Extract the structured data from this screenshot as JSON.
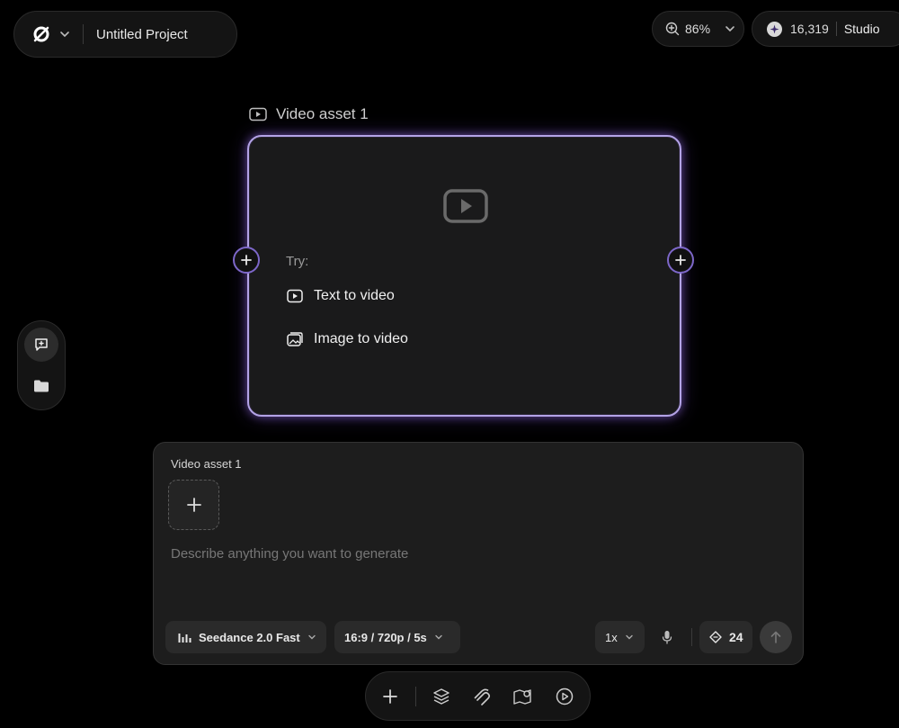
{
  "header": {
    "project_title": "Untitled Project",
    "zoom_label": "86%",
    "credits": "16,319",
    "plan_label": "Studio"
  },
  "canvas": {
    "asset_title": "Video asset 1",
    "try_label": "Try:",
    "options": [
      {
        "label": "Text to video",
        "icon": "video-play-icon"
      },
      {
        "label": "Image to video",
        "icon": "image-icon"
      }
    ]
  },
  "prompt_panel": {
    "asset_label": "Video asset 1",
    "placeholder": "Describe anything you want to generate",
    "model_label": "Seedance 2.0 Fast",
    "format_label": "16:9 / 720p / 5s",
    "count_label": "1x",
    "cost_value": "24"
  },
  "bottom_toolbar": {
    "icons": [
      "plus-icon",
      "layers-icon",
      "magnet-icon",
      "map-icon",
      "play-circle-icon"
    ]
  },
  "colors": {
    "background": "#000000",
    "accent": "#8b72d9",
    "panel": "#1d1d1d"
  }
}
